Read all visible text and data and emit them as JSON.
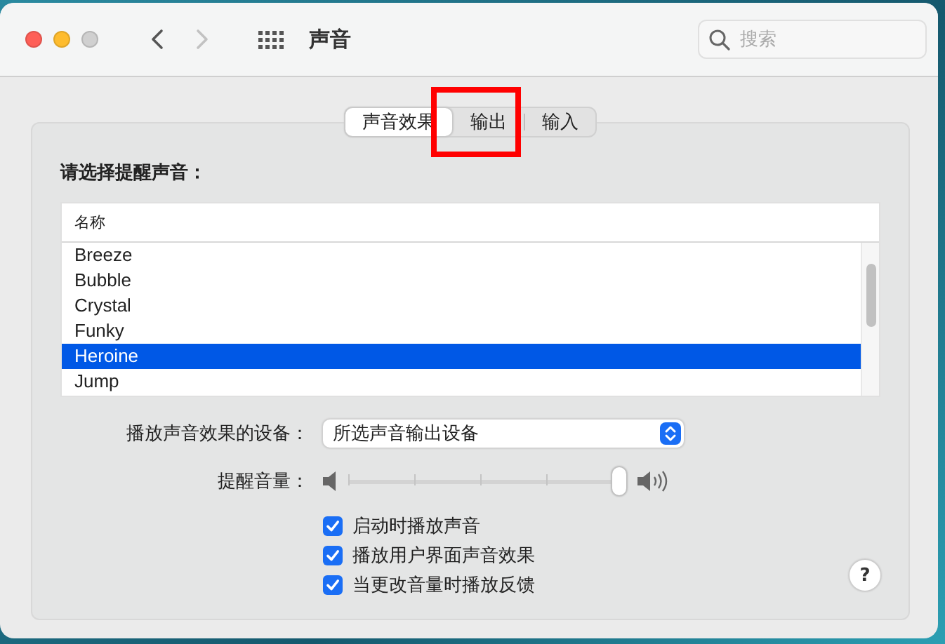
{
  "window": {
    "title": "声音",
    "search": {
      "placeholder": "搜索"
    }
  },
  "nav": [
    {
      "kind": "back",
      "disabled": false
    },
    {
      "kind": "forward",
      "disabled": true
    }
  ],
  "tabs": [
    {
      "label": "声音效果",
      "selected": true
    },
    {
      "label": "输出",
      "selected": false
    },
    {
      "label": "输入",
      "selected": false
    }
  ],
  "alert_sounds": {
    "label": "请选择提醒声音：",
    "column": "名称",
    "rows": [
      {
        "name": "Breeze",
        "selected": false
      },
      {
        "name": "Bubble",
        "selected": false
      },
      {
        "name": "Crystal",
        "selected": false
      },
      {
        "name": "Funky",
        "selected": false
      },
      {
        "name": "Heroine",
        "selected": true
      },
      {
        "name": "Jump",
        "selected": false
      }
    ]
  },
  "device": {
    "label": "播放声音效果的设备：",
    "value": "所选声音输出设备"
  },
  "alert_volume": {
    "label": "提醒音量：",
    "level": 1.0
  },
  "options": [
    {
      "label": "启动时播放声音",
      "checked": true
    },
    {
      "label": "播放用户界面声音效果",
      "checked": true
    },
    {
      "label": "当更改音量时播放反馈",
      "checked": true
    }
  ],
  "help": "?"
}
